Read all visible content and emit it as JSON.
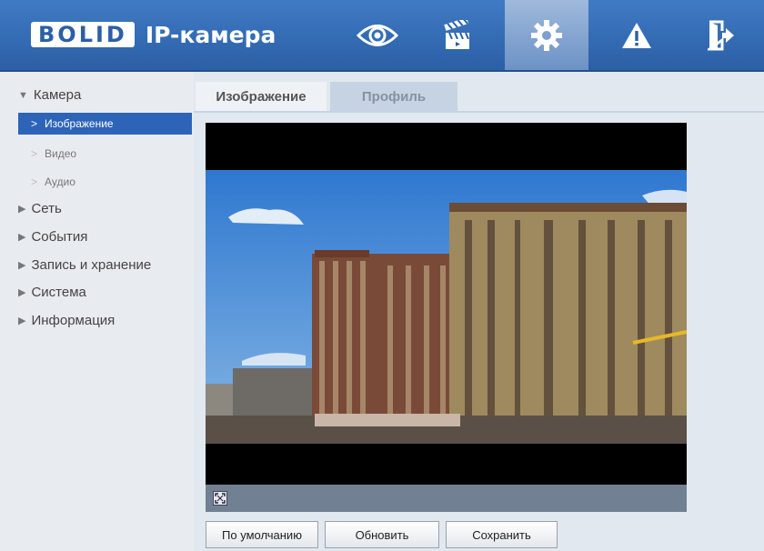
{
  "header": {
    "logo_text": "BOLID",
    "title": "IP-камера",
    "nav": [
      {
        "icon": "eye-icon",
        "active": false
      },
      {
        "icon": "clapperboard-icon",
        "active": false
      },
      {
        "icon": "gear-icon",
        "active": true
      },
      {
        "icon": "warning-icon",
        "active": false
      },
      {
        "icon": "logout-icon",
        "active": false
      }
    ]
  },
  "sidebar": {
    "camera_label": "Камера",
    "items": [
      {
        "label": "Изображение",
        "active": true
      },
      {
        "label": "Видео",
        "active": false
      },
      {
        "label": "Аудио",
        "active": false
      }
    ],
    "sections": [
      "Сеть",
      "События",
      "Запись и хранение",
      "Система",
      "Информация"
    ]
  },
  "tabs": [
    {
      "label": "Изображение",
      "active": true
    },
    {
      "label": "Профиль",
      "active": false
    }
  ],
  "video": {
    "fullscreen_icon": "fullscreen-icon"
  },
  "buttons": {
    "default_label": "По умолчанию",
    "refresh_label": "Обновить",
    "save_label": "Сохранить"
  },
  "colors": {
    "header_blue": "#2b5fa6",
    "active_item": "#2d64b8"
  }
}
